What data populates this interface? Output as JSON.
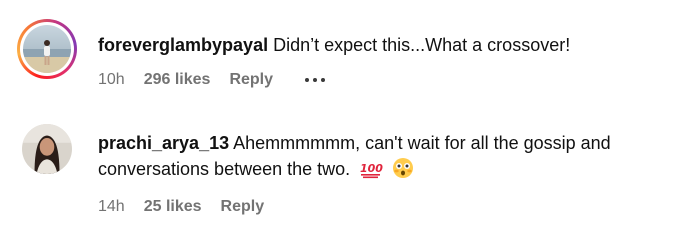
{
  "comments": [
    {
      "username": "foreverglambypayal",
      "text": "Didn’t expect this...What a crossover!",
      "time": "10h",
      "likes": "296 likes",
      "reply": "Reply",
      "avatar_icon": "profile-photo-beach",
      "has_story_ring": true
    },
    {
      "username": "prachi_arya_13",
      "text": "Ahemmmmmm, can't wait for all the gossip and conversations between the two.",
      "emojis": [
        "hundred-points-emoji",
        "flushed-face-emoji"
      ],
      "time": "14h",
      "likes": "25 likes",
      "reply": "Reply",
      "avatar_icon": "profile-photo-portrait",
      "has_story_ring": false
    }
  ],
  "colors": {
    "text": "#111111",
    "muted": "#737373",
    "ring": "#e1306c"
  }
}
